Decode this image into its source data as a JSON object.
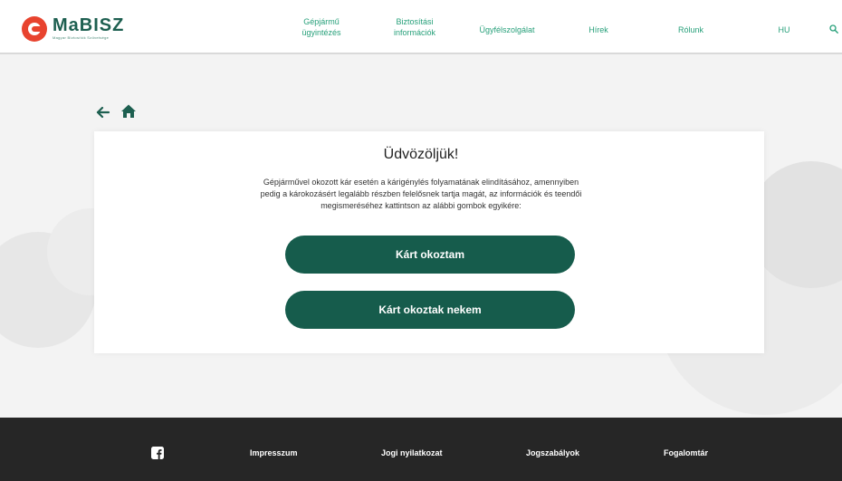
{
  "brand": {
    "name": "MaBISZ",
    "tagline": "Magyar Biztosítók Szövetsége"
  },
  "nav": {
    "items": [
      "Gépjármű ügyintézés",
      "Biztosítási információk",
      "Ügyfélszolgálat",
      "Hírek",
      "Rólunk",
      "HU"
    ]
  },
  "icons": {
    "search": "search-icon",
    "back": "arrow-left-icon",
    "home": "home-icon",
    "facebook": "facebook-icon"
  },
  "main": {
    "title": "Üdvözöljük!",
    "description": "Gépjárművel okozott kár esetén a kárigénylés folyamatának elindításához, amennyiben pedig a károkozásért legalább részben felelősnek tartja magát, az információk és teendői megismeréséhez kattintson az alábbi gombok egyikére:",
    "buttons": [
      "Kárt okoztam",
      "Kárt okoztak nekem"
    ]
  },
  "footer": {
    "links": [
      "Impresszum",
      "Jogi nyilatkozat",
      "Jogszabályok",
      "Fogalomtár"
    ]
  },
  "colors": {
    "accent": "#165c4c",
    "nav_text": "#27a07a",
    "logo_red": "#e8432e",
    "footer_bg": "#262626"
  }
}
